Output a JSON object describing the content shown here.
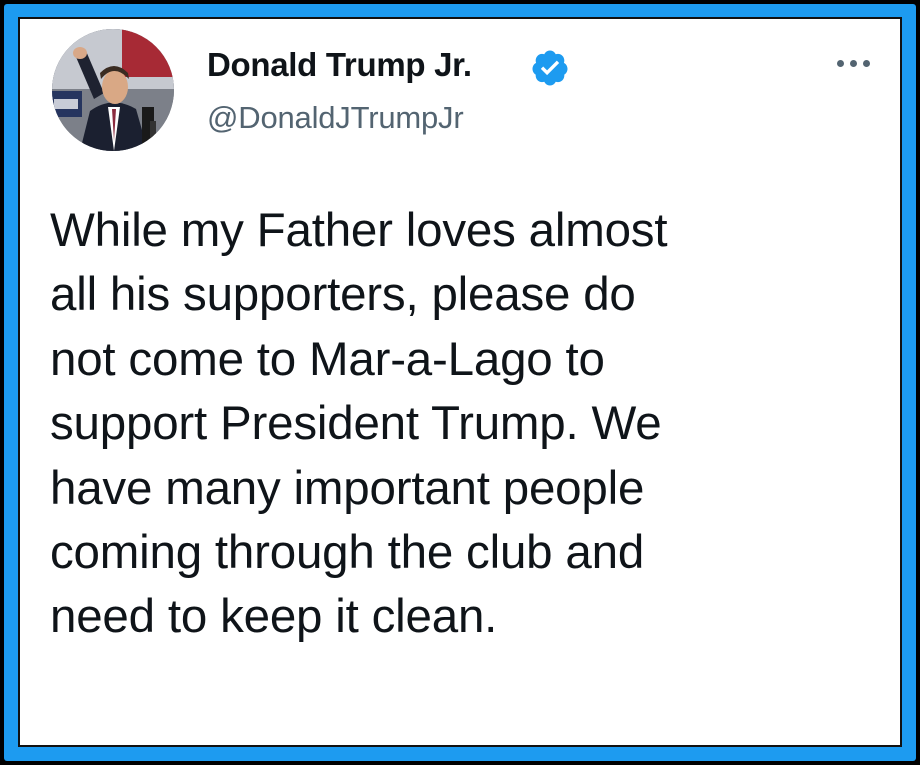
{
  "tweet": {
    "author": {
      "display_name": "Donald Trump Jr.",
      "handle": "@DonaldJTrumpJr",
      "verified": true,
      "verified_icon": "verified-badge-icon"
    },
    "more_icon": "more-horizontal-icon",
    "text": "While my Father loves almost\nall his supporters, please do\nnot come to Mar-a-Lago to\nsupport President Trump. We\nhave many important people\ncoming through the club and\nneed to keep it clean."
  },
  "colors": {
    "frame_blue": "#1d9bf0",
    "outer_border": "#000000",
    "card_background": "#ffffff",
    "text_primary": "#0f1419",
    "text_secondary": "#536471",
    "verified_blue": "#1d9bf0"
  }
}
